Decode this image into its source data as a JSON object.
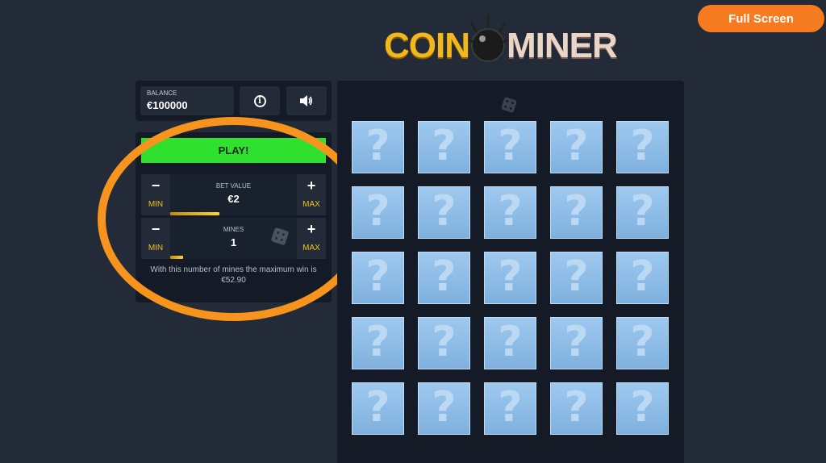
{
  "header": {
    "fullscreen_label": "Full Screen",
    "logo_left": "COIN",
    "logo_right": "MINER"
  },
  "balance": {
    "label": "BALANCE",
    "value": "€100000"
  },
  "controls": {
    "info_icon": "info-icon",
    "sound_icon": "speaker-icon",
    "play_label": "PLAY!"
  },
  "bet": {
    "label": "BET VALUE",
    "value": "€2",
    "minus": "−",
    "plus": "+",
    "min_label": "MIN",
    "max_label": "MAX",
    "level": 0.39
  },
  "mines": {
    "label": "MINES",
    "value": "1",
    "minus": "−",
    "plus": "+",
    "min_label": "MIN",
    "max_label": "MAX",
    "level": 0.1
  },
  "max_win_text": "With this number of mines the maximum win is €52.90",
  "board": {
    "tile_symbol": "?",
    "rows": 5,
    "cols": 5
  },
  "colors": {
    "accent_play": "#2fe02f",
    "fullscreen": "#f57a20",
    "highlight": "#f7941d",
    "tile": "#9ec9f0"
  }
}
